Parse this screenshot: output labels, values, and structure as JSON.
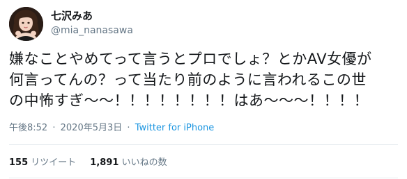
{
  "tweet": {
    "user": {
      "display_name": "七沢みあ",
      "screen_name": "@mia_nanasawa"
    },
    "text_lines": [
      "嫌なことやめてって言うとプロでしょ？とかAV女優が",
      "何言ってんの？って当たり前のように言われるこの世",
      "の中怖すぎ〜〜！！！！！！！！はあ〜〜〜！！！！"
    ],
    "meta": {
      "time": "午後8:52",
      "separator": "·",
      "date": "2020年5月3日",
      "source": "Twitter for iPhone"
    },
    "stats": {
      "retweets_count": "155",
      "retweets_label": "リツイート",
      "likes_count": "1,891",
      "likes_label": "いいねの数"
    }
  },
  "colors": {
    "text": "#14171a",
    "secondary": "#657786",
    "link": "#1b95e0",
    "divider": "#e6ecf0"
  }
}
